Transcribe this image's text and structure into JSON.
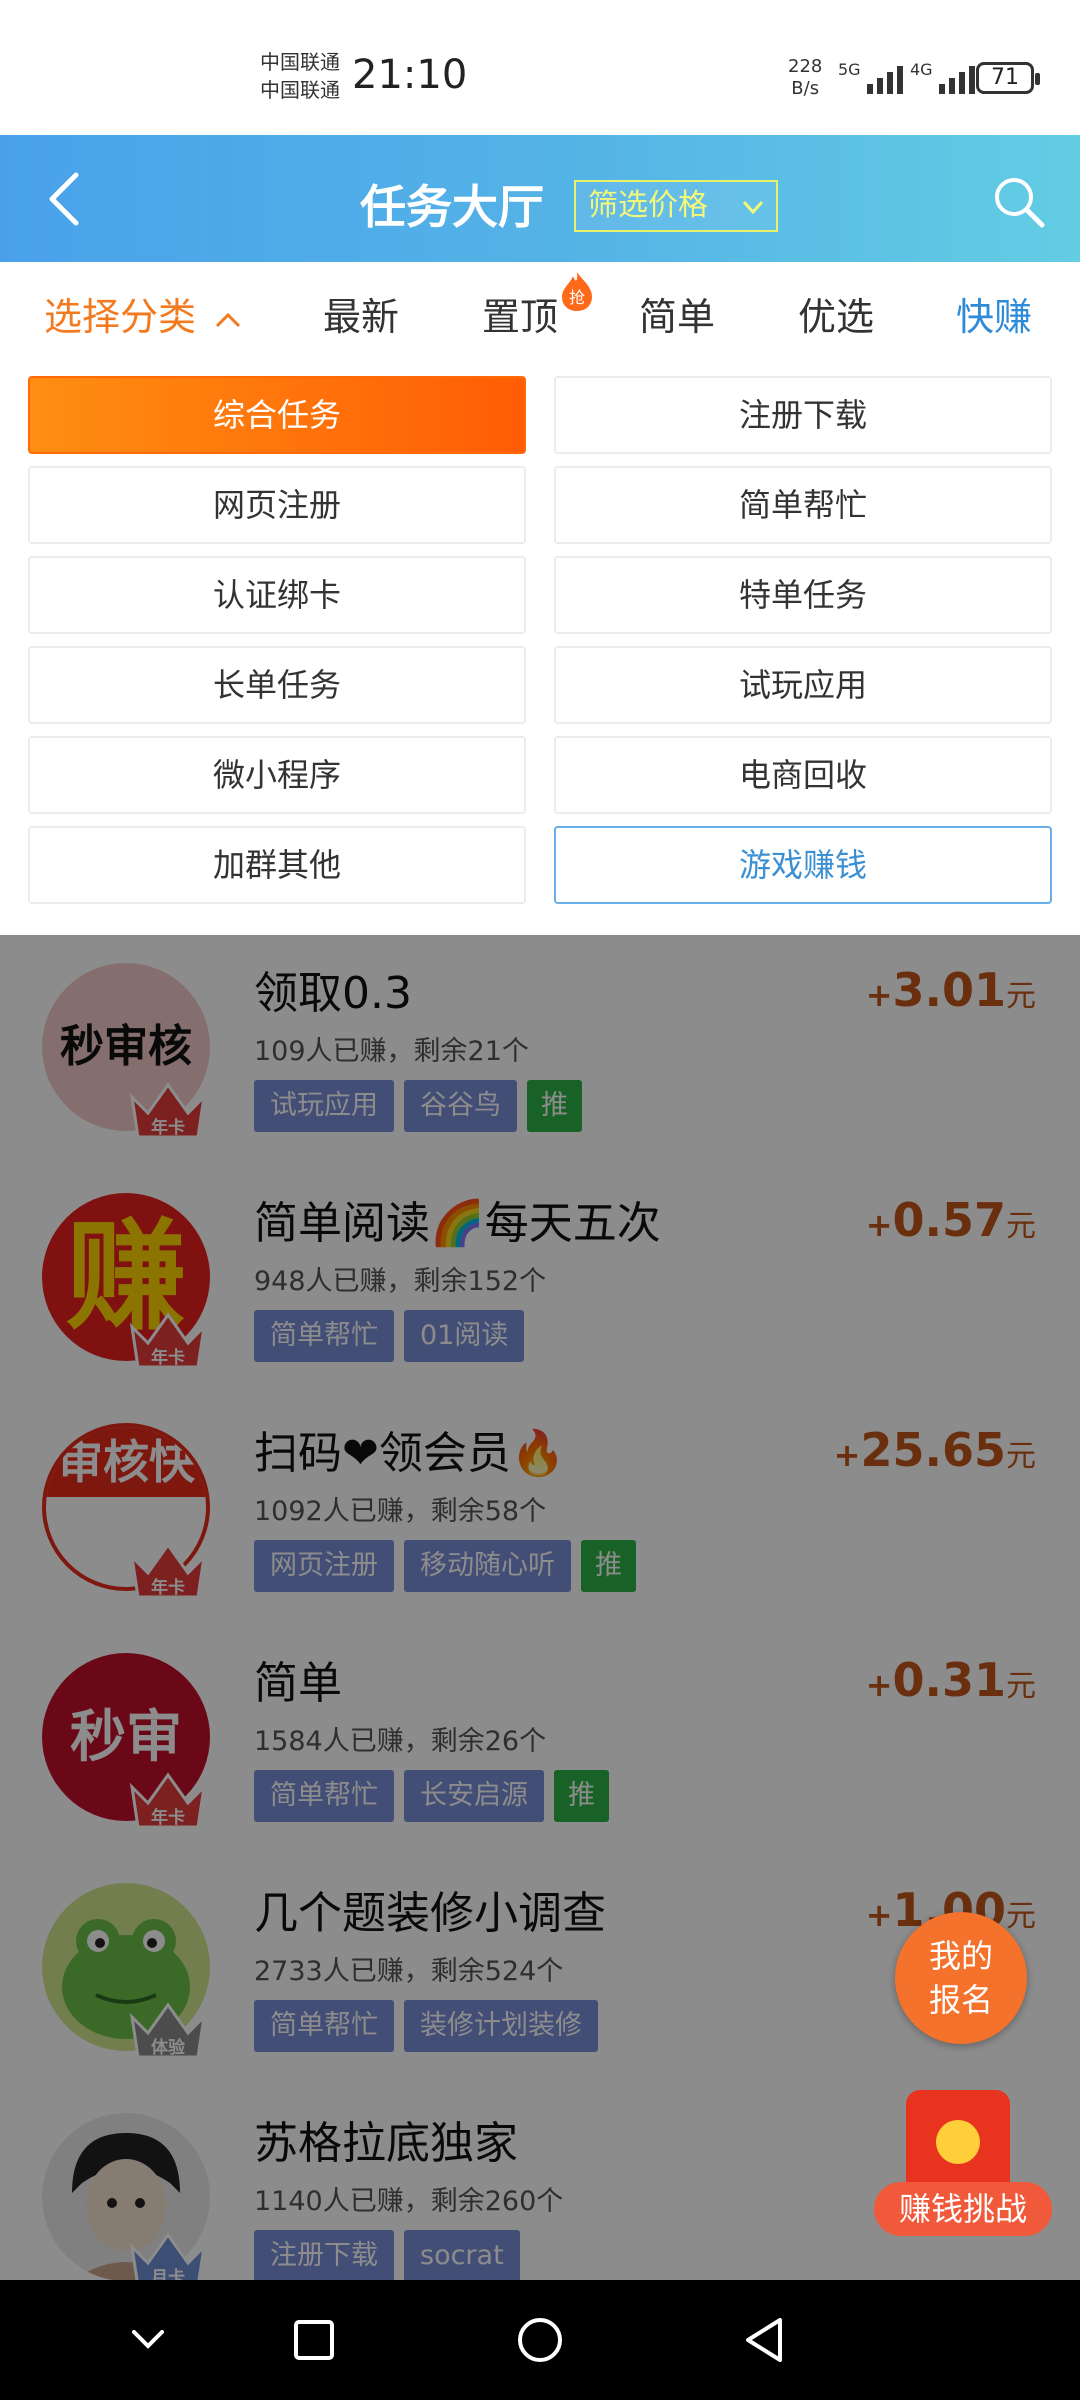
{
  "status_bar": {
    "carrier_1": "中国联通",
    "carrier_2": "中国联通",
    "time": "21:10",
    "net_speed_value": "228",
    "net_speed_unit": "B/s",
    "signal_1_label": "5G",
    "signal_2_label": "4G",
    "battery": "71"
  },
  "header": {
    "title": "任务大厅",
    "filter_label": "筛选价格"
  },
  "tabs": [
    {
      "label": "选择分类"
    },
    {
      "label": "最新"
    },
    {
      "label": "置顶",
      "badge": "抢"
    },
    {
      "label": "简单"
    },
    {
      "label": "优选"
    },
    {
      "label": "快赚"
    }
  ],
  "categories": [
    "综合任务",
    "注册下载",
    "网页注册",
    "简单帮忙",
    "认证绑卡",
    "特单任务",
    "长单任务",
    "试玩应用",
    "微小程序",
    "电商回收",
    "加群其他",
    "游戏赚钱"
  ],
  "tasks": [
    {
      "title": "领取0.3",
      "meta": "109人已赚，剩余21个",
      "tags": [
        "试玩应用",
        "谷谷鸟"
      ],
      "rec": "推",
      "price": "3.01",
      "avatar_text": "秒审核",
      "tier": "年卡"
    },
    {
      "title": "简单阅读🌈每天五次",
      "meta": "948人已赚，剩余152个",
      "tags": [
        "简单帮忙",
        "01阅读"
      ],
      "rec": "",
      "price": "0.57",
      "avatar_text": "赚",
      "tier": "年卡"
    },
    {
      "title": "扫码❤领会员🔥",
      "meta": "1092人已赚，剩余58个",
      "tags": [
        "网页注册",
        "移动随心听"
      ],
      "rec": "推",
      "price": "25.65",
      "avatar_text": "审核快",
      "tier": "年卡"
    },
    {
      "title": "简单",
      "meta": "1584人已赚，剩余26个",
      "tags": [
        "简单帮忙",
        "长安启源"
      ],
      "rec": "推",
      "price": "0.31",
      "avatar_text": "秒审",
      "tier": "年卡"
    },
    {
      "title": "几个题装修小调查",
      "meta": "2733人已赚，剩余524个",
      "tags": [
        "简单帮忙",
        "装修计划装修"
      ],
      "rec": "",
      "price": "1.00",
      "avatar_text": "",
      "tier": "体验"
    },
    {
      "title": "苏格拉底独家",
      "meta": "1140人已赚，剩余260个",
      "tags": [
        "注册下载",
        "socrat"
      ],
      "rec": "",
      "price": "",
      "avatar_text": "",
      "tier": "月卡"
    }
  ],
  "price_plus": "+",
  "price_unit": "元",
  "floating": {
    "my_signup_line1": "我的",
    "my_signup_line2": "报名",
    "challenge": "赚钱挑战"
  },
  "colors": {
    "header_start": "#4aa1ea",
    "header_end": "#63cde4",
    "accent_orange": "#f37a1f",
    "accent_blue": "#2e8bd8",
    "price": "#c2571a",
    "tag": "#7b8fd8",
    "rec_tag": "#2fb247"
  }
}
